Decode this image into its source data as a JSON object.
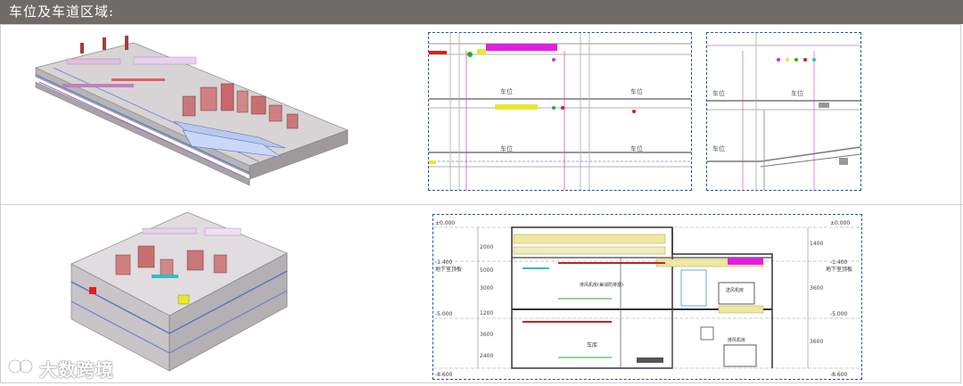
{
  "header": {
    "title": "车位及车道区域:"
  },
  "plan_top_left": {
    "parking_labels": [
      "车位",
      "车位",
      "车位",
      "车位"
    ]
  },
  "plan_top_right": {
    "parking_labels": [
      "车位",
      "车位",
      "车位"
    ]
  },
  "section": {
    "levels_left": [
      "±0.000",
      "-1.400",
      "地下室顶板",
      "-5.000",
      "-8.600"
    ],
    "levels_right": [
      "±0.000",
      "-1.400",
      "地下室顶板",
      "-5.000",
      "-8.600"
    ],
    "dims_left": [
      "2000",
      "5000",
      "3000",
      "1200",
      "3600",
      "2400"
    ],
    "dims_right": [
      "1400",
      "3600",
      "3600"
    ],
    "room_labels": [
      "排风机房(兼消防排烟)",
      "车库",
      "送风机房",
      "排风机房"
    ]
  },
  "watermark": {
    "text": "大数跨境",
    "logo": "link-logo-icon"
  },
  "colors": {
    "header_bg": "#6e6b68",
    "magenta": "#e020e0",
    "yellow": "#e8e830",
    "red": "#c82020",
    "green": "#20b020",
    "cyan": "#30c0c0",
    "blue_dash": "#3050a0"
  }
}
